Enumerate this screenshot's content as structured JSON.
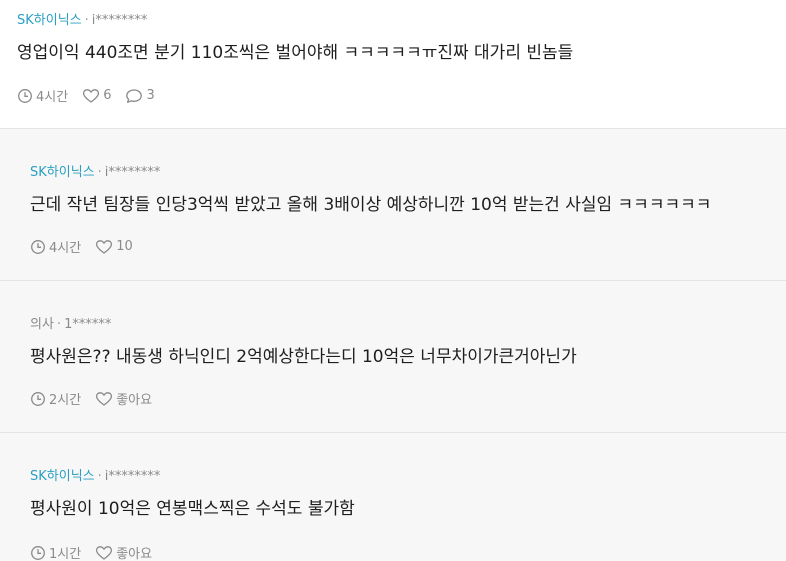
{
  "comments": [
    {
      "company": "SK하이닉스",
      "author": "i********",
      "text": "영업이익 440조면 분기 110조씩은 벌어야해 ㅋㅋㅋㅋㅋㅠ진짜 대가리 빈놈들",
      "time": "4시간",
      "likes": "6",
      "replies": "3"
    },
    {
      "company": "SK하이닉스",
      "author": "i********",
      "text": "근데 작년 팀장들 인당3억씩 받았고 올해 3배이상 예상하니깐 10억 받는건 사실임 ㅋㅋㅋㅋㅋㅋ",
      "time": "4시간",
      "likes": "10"
    },
    {
      "company": "의사",
      "author": "1******",
      "text": "평사원은?? 내동생 하닉인디 2억예상한다는디 10억은 너무차이가큰거아닌가",
      "time": "2시간",
      "likes": "좋아요"
    },
    {
      "company": "SK하이닉스",
      "author": "i********",
      "text": "평사원이 10억은 연봉맥스찍은 수석도 불가함",
      "time": "1시간",
      "likes": "좋아요"
    }
  ],
  "separator": "·",
  "icons": {
    "time": "clock-icon",
    "like": "heart-icon",
    "reply": "speech-bubble-icon"
  },
  "colors": {
    "company_link": "#2a9fc4",
    "reply_background": "#f7f7f7",
    "muted_text": "#8a8a8a"
  }
}
